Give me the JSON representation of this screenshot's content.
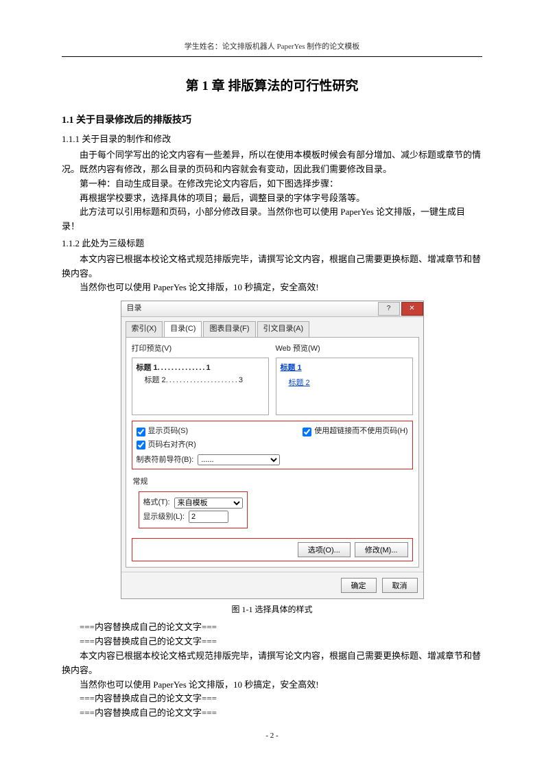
{
  "header": "学生姓名：论文排版机器人 PaperYes 制作的论文模板",
  "chapter_title": "第 1 章 排版算法的可行性研究",
  "section_1_1": "1.1 关于目录修改后的排版技巧",
  "section_1_1_1": "1.1.1 关于目录的制作和修改",
  "p1": "由于每个同学写出的论文内容有一些差异，所以在使用本模板时候会有部分增加、减少标题或章节的情况。既然内容有修改，那么目录的页码和内容就会有变动，因此我们需要修改目录。",
  "p2": "第一种：自动生成目录。在修改完论文内容后，如下图选择步骤：",
  "p3": "再根据学校要求，选择具体的项目；最后，调整目录的字体字号段落等。",
  "p4": "此方法可以引用标题和页码，小部分修改目录。当然你也可以使用 PaperYes 论文排版，一键生成目录！",
  "section_1_1_2": "1.1.2 此处为三级标题",
  "p5": "本文内容已根据本校论文格式规范排版完毕，请撰写论文内容，根据自己需要更换标题、增减章节和替换内容。",
  "p6": "当然你也可以使用 PaperYes 论文排版，10 秒搞定，安全高效!",
  "dialog": {
    "title": "目录",
    "tabs": [
      "索引(X)",
      "目录(C)",
      "图表目录(F)",
      "引文目录(A)"
    ],
    "print_preview_label": "打印预览(V)",
    "web_preview_label": "Web 预览(W)",
    "print_lines": {
      "h1": "标题 1",
      "h1_page": "1",
      "h2": "标题 2",
      "h2_page": "3"
    },
    "web_links": [
      "标题 1",
      "标题 2"
    ],
    "ck_show_pages": "显示页码(S)",
    "ck_right_align": "页码右对齐(R)",
    "ck_hyperlink": "使用超链接而不使用页码(H)",
    "leader_label": "制表符前导符(B):",
    "leader_value": "......",
    "general_label": "常规",
    "format_label": "格式(T):",
    "format_value": "来自模板",
    "levels_label": "显示级别(L):",
    "levels_value": "2",
    "btn_options": "选项(O)...",
    "btn_modify": "修改(M)...",
    "btn_ok": "确定",
    "btn_cancel": "取消"
  },
  "fig_caption": "图 1-1 选择具体的样式",
  "p7": "===内容替换成自己的论文文字===",
  "p8": "===内容替换成自己的论文文字===",
  "p9": "本文内容已根据本校论文格式规范排版完毕，请撰写论文内容，根据自己需要更换标题、增减章节和替换内容。",
  "p10": "当然你也可以使用 PaperYes 论文排版，10 秒搞定，安全高效!",
  "p11": "===内容替换成自己的论文文字===",
  "p12": "===内容替换成自己的论文文字===",
  "page_number": "- 2 -"
}
